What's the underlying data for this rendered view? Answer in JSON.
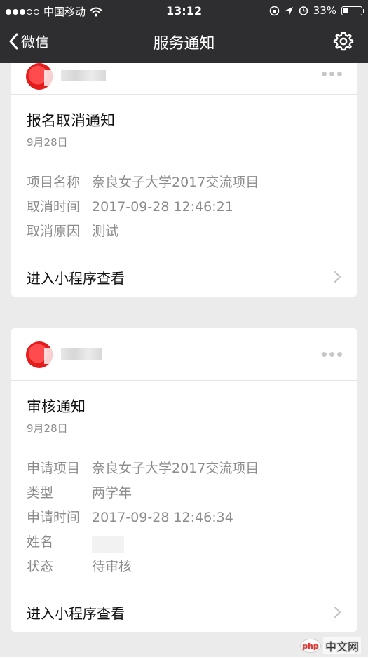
{
  "status_bar": {
    "carrier": "中国移动",
    "time": "13:12",
    "battery": "33%",
    "battery_level": 0.33,
    "signal_filled": 3,
    "signal_total": 5
  },
  "nav": {
    "back_label": "微信",
    "title": "服务通知"
  },
  "cards": [
    {
      "title": "报名取消通知",
      "date": "9月28日",
      "fields": [
        {
          "label": "项目名称",
          "value": "奈良女子大学2017交流项目"
        },
        {
          "label": "取消时间",
          "value": "2017-09-28 12:46:21"
        },
        {
          "label": "取消原因",
          "value": "测试"
        }
      ],
      "footer": "进入小程序查看"
    },
    {
      "title": "审核通知",
      "date": "9月28日",
      "fields": [
        {
          "label": "申请项目",
          "value": "奈良女子大学2017交流项目"
        },
        {
          "label": "类型",
          "value": "两学年"
        },
        {
          "label": "申请时间",
          "value": "2017-09-28 12:46:34"
        },
        {
          "label": "姓名",
          "value": ""
        },
        {
          "label": "状态",
          "value": "待审核"
        }
      ],
      "footer": "进入小程序查看"
    }
  ],
  "watermark": {
    "logo": "php",
    "site": "中文网"
  },
  "colors": {
    "nav_bg": "#2e2e31",
    "page_bg": "#ebebeb",
    "muted_text": "#8c8c8c"
  },
  "icons": {
    "back": "chevron-left-icon",
    "settings": "gear-icon",
    "more": "more-dots-icon",
    "footer_arrow": "chevron-right-icon"
  }
}
